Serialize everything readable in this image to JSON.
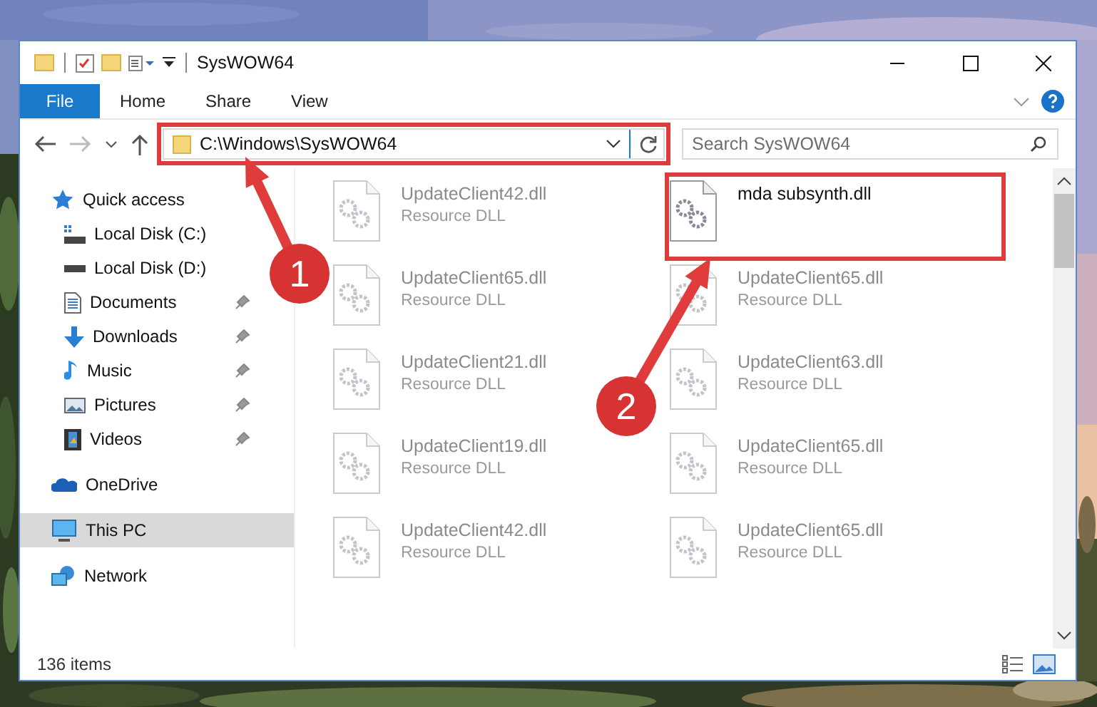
{
  "window": {
    "title": "SysWOW64"
  },
  "ribbon": {
    "tabs": [
      {
        "label": "File",
        "kind": "file"
      },
      {
        "label": "Home",
        "kind": "tab"
      },
      {
        "label": "Share",
        "kind": "tab"
      },
      {
        "label": "View",
        "kind": "tab"
      }
    ]
  },
  "address": {
    "path": "C:\\Windows\\SysWOW64",
    "highlighted": true
  },
  "search": {
    "placeholder": "Search SysWOW64"
  },
  "sidebar": {
    "items": [
      {
        "label": "Quick access",
        "selected": false,
        "children": [
          {
            "label": "Local Disk (C:)",
            "pinned": false,
            "selected": false
          },
          {
            "label": "Local Disk (D:)",
            "pinned": false,
            "selected": false
          },
          {
            "label": "Documents",
            "pinned": true,
            "selected": false
          },
          {
            "label": "Downloads",
            "pinned": true,
            "selected": false
          },
          {
            "label": "Music",
            "pinned": true,
            "selected": false
          },
          {
            "label": "Pictures",
            "pinned": true,
            "selected": false
          },
          {
            "label": "Videos",
            "pinned": true,
            "selected": false
          }
        ]
      },
      {
        "label": "OneDrive",
        "selected": false
      },
      {
        "label": "This PC",
        "selected": true
      },
      {
        "label": "Network",
        "selected": false
      }
    ]
  },
  "files": [
    {
      "name": "UpdateClient42.dll",
      "type": "Resource DLL",
      "dimmed": true,
      "highlighted": false
    },
    {
      "name": "mda subsynth.dll",
      "dimmed": false,
      "highlighted": true
    },
    {
      "name": "UpdateClient65.dll",
      "type": "Resource DLL",
      "dimmed": true,
      "highlighted": false
    },
    {
      "name": "UpdateClient65.dll",
      "type": "Resource DLL",
      "dimmed": true,
      "highlighted": false
    },
    {
      "name": "UpdateClient21.dll",
      "type": "Resource DLL",
      "dimmed": true,
      "highlighted": false
    },
    {
      "name": "UpdateClient63.dll",
      "type": "Resource DLL",
      "dimmed": true,
      "highlighted": false
    },
    {
      "name": "UpdateClient19.dll",
      "type": "Resource DLL",
      "dimmed": true,
      "highlighted": false
    },
    {
      "name": "UpdateClient65.dll",
      "type": "Resource DLL",
      "dimmed": true,
      "highlighted": false
    },
    {
      "name": "UpdateClient42.dll",
      "type": "Resource DLL",
      "dimmed": true,
      "highlighted": false
    },
    {
      "name": "UpdateClient65.dll",
      "type": "Resource DLL",
      "dimmed": true,
      "highlighted": false
    }
  ],
  "callouts": [
    {
      "number": "1"
    },
    {
      "number": "2"
    }
  ],
  "status_bar": {
    "text": "136 items"
  }
}
